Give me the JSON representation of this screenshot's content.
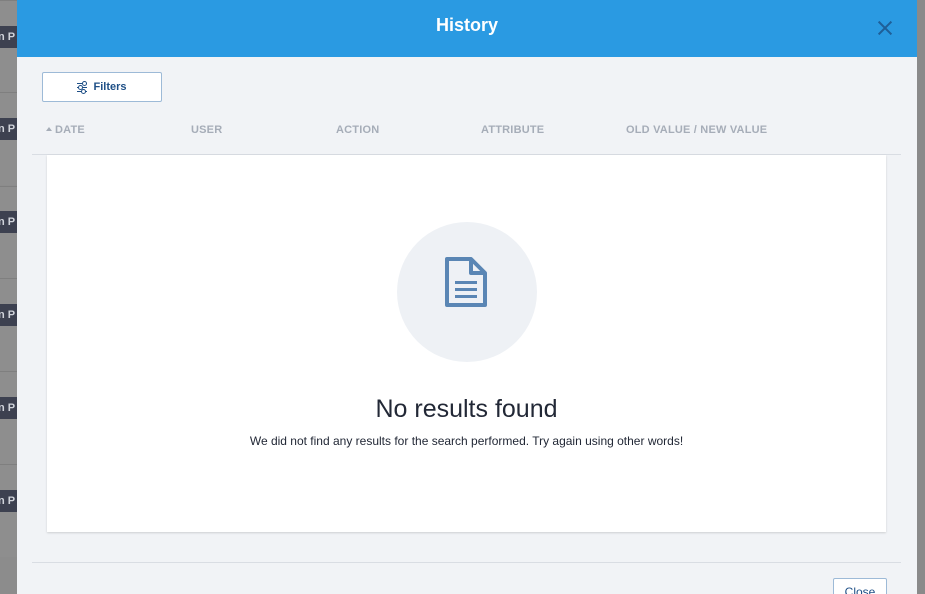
{
  "background": {
    "tags": [
      "n P",
      "n P",
      "n P",
      "n P",
      "n P",
      "n P"
    ]
  },
  "modal": {
    "title": "History",
    "close_icon": "close-icon",
    "filters_label": "Filters",
    "filters_icon": "sliders-icon",
    "columns": [
      "DATE",
      "USER",
      "ACTION",
      "ATTRIBUTE",
      "OLD VALUE / NEW VALUE"
    ],
    "sort": {
      "column": "DATE",
      "direction": "ascending"
    },
    "empty_state": {
      "icon": "document-icon",
      "title": "No results found",
      "message": "We did not find any results for the search performed. Try again using other words!"
    },
    "close_button_label": "Close"
  },
  "colors": {
    "header": "#2a9ae2",
    "accent": "#1e4f86",
    "icon": "#5a86b4"
  }
}
